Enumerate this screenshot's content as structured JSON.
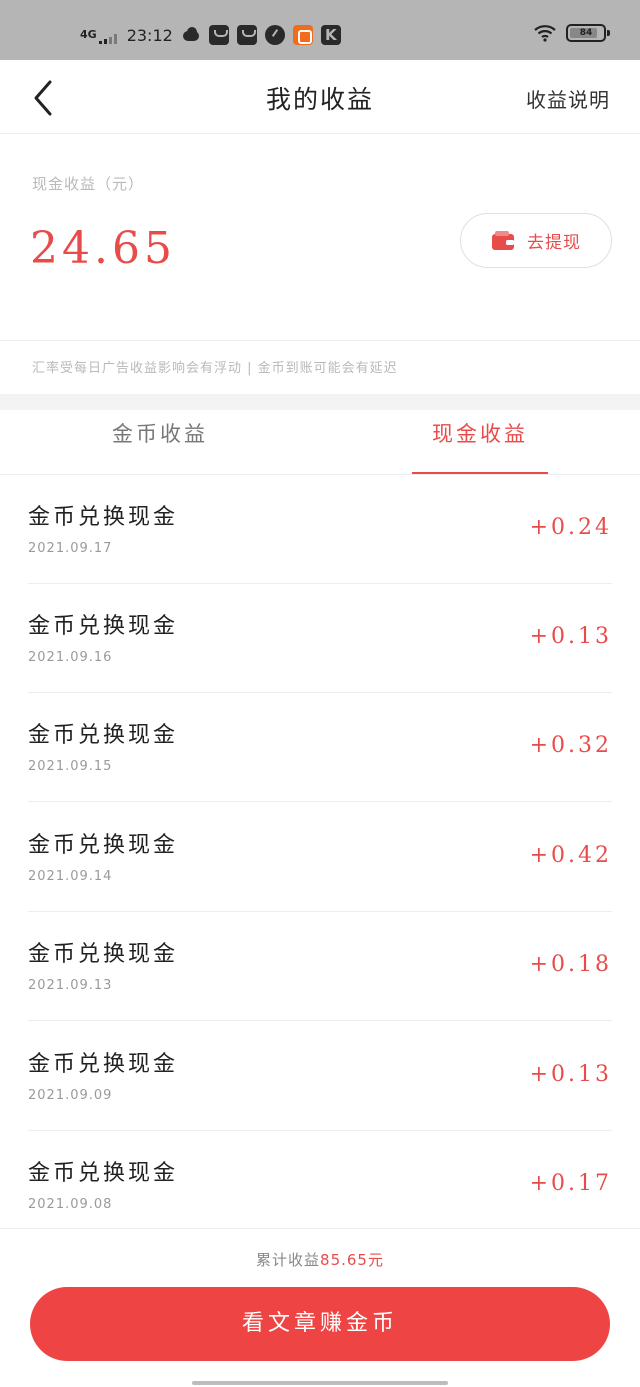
{
  "status_bar": {
    "network": "4G",
    "time": "23:12",
    "battery": "84",
    "battery_level_percent": 84,
    "app_icons": [
      "cloud-icon",
      "shopping-bag-icon",
      "shopping-bag-icon",
      "compass-icon",
      "orange-app-icon",
      "k-app-icon"
    ],
    "k_label": "K"
  },
  "nav": {
    "title": "我的收益",
    "right_link": "收益说明"
  },
  "earnings": {
    "label": "现金收益（元）",
    "amount": "24.65",
    "withdraw_label": "去提现",
    "notice": "汇率受每日广告收益影响会有浮动 | 金币到账可能会有延迟"
  },
  "tabs": [
    {
      "label": "金币收益",
      "active": false
    },
    {
      "label": "现金收益",
      "active": true
    }
  ],
  "records": [
    {
      "title": "金币兑换现金",
      "date": "2021.09.17",
      "amount": "+0.24"
    },
    {
      "title": "金币兑换现金",
      "date": "2021.09.16",
      "amount": "+0.13"
    },
    {
      "title": "金币兑换现金",
      "date": "2021.09.15",
      "amount": "+0.32"
    },
    {
      "title": "金币兑换现金",
      "date": "2021.09.14",
      "amount": "+0.42"
    },
    {
      "title": "金币兑换现金",
      "date": "2021.09.13",
      "amount": "+0.18"
    },
    {
      "title": "金币兑换现金",
      "date": "2021.09.09",
      "amount": "+0.13"
    },
    {
      "title": "金币兑换现金",
      "date": "2021.09.08",
      "amount": "+0.17"
    }
  ],
  "footer": {
    "total_prefix": "累计收益",
    "total_value": "85.65元",
    "cta_label": "看文章赚金币"
  },
  "colors": {
    "accent": "#e84c4a",
    "cta_background": "#ee4444",
    "status_bar": "#b5b5b5"
  }
}
